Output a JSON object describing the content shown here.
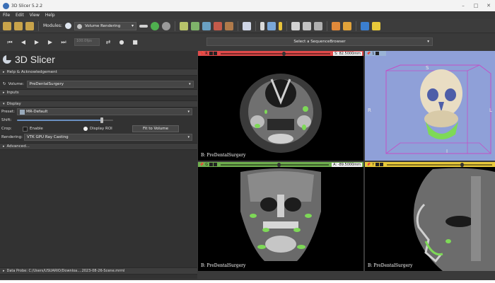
{
  "window": {
    "title": "3D Slicer 5.2.2",
    "controls": [
      "–",
      "□",
      "✕"
    ]
  },
  "menu": [
    "File",
    "Edit",
    "View",
    "Help"
  ],
  "toolbar": {
    "modules_label": "Modules:",
    "module_selected": "Volume Rendering"
  },
  "sequence": {
    "fps": "100.0fps",
    "browser_label": "Select a SequenceBrowser"
  },
  "panel": {
    "app_name": "3D Slicer",
    "help_section": "Help & Acknowledgement",
    "volume_label": "Volume:",
    "volume_value": "PreDentalSurgery",
    "inputs_section": "Inputs",
    "display_section": "Display",
    "preset_label": "Preset:",
    "preset_value": "MR-Default",
    "shift_label": "Shift:",
    "shift_level": 0.87,
    "crop_label": "Crop:",
    "enable_label": "Enable",
    "display_roi_label": "Display ROI",
    "fit_button": "Fit to Volume",
    "rendering_label": "Rendering:",
    "rendering_value": "VTK GPU Ray Casting",
    "advanced_section": "Advanced...",
    "data_probe": "Data Probe: C:/Users/USUARIO/Downloa....2023-08-26-Scene.mrml"
  },
  "views": {
    "red": {
      "id": "R",
      "offset": "S: 82.5000mm",
      "caption": "B: PreDentalSurgery",
      "color": "#e04a4a"
    },
    "three_d": {
      "id": "1",
      "axis_s": "S",
      "axis_r": "R",
      "axis_l": "L",
      "axis_i": "I",
      "color": "#9ab3d6"
    },
    "green": {
      "id": "G",
      "offset": "A: -89.5000mm",
      "caption": "B: PreDentalSurgery",
      "color": "#6fae4e"
    },
    "yellow": {
      "id": "Y",
      "caption": "B: PreDentalSurgery",
      "color": "#e8c83a"
    }
  },
  "colors": {
    "accent_blue": "#3b6fb6",
    "segmentation_green": "#7ed957",
    "three_d_background": "#8fa0d8"
  }
}
